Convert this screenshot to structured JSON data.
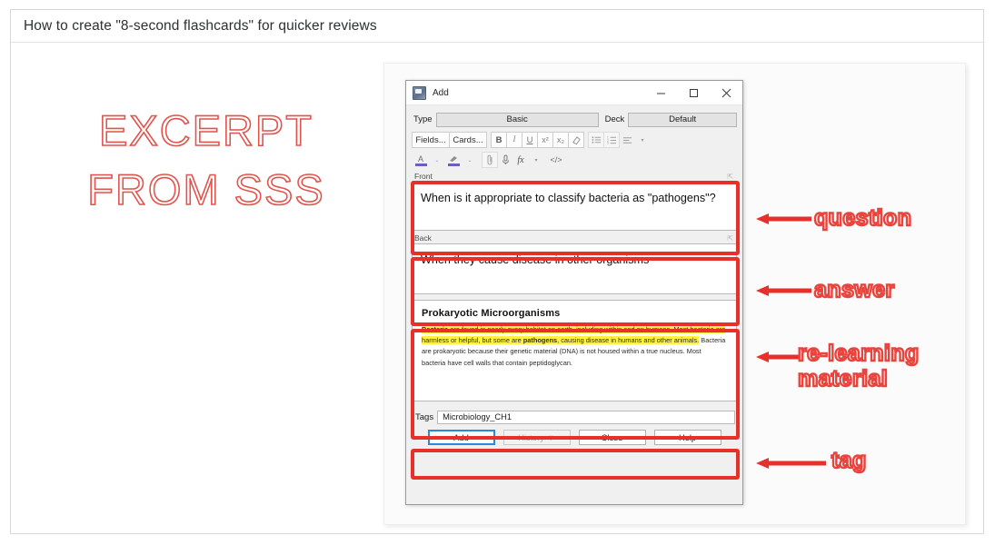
{
  "page": {
    "title": "How to create \"8-second flashcards\" for quicker reviews"
  },
  "watermark": {
    "line1": "EXCERPT",
    "line2": "FROM SSS",
    "color": "#e2534c"
  },
  "anki": {
    "window_title": "Add",
    "app_icon": "anki-app-icon",
    "window_controls": {
      "minimize": "minimize-icon",
      "maximize": "maximize-icon",
      "close": "close-icon"
    },
    "type_label": "Type",
    "type_value": "Basic",
    "deck_label": "Deck",
    "deck_value": "Default",
    "toolbar": {
      "fields_button": "Fields...",
      "cards_button": "Cards...",
      "bold": "B",
      "italic": "I",
      "underline": "U",
      "superscript": "x²",
      "subscript": "x₂",
      "remove_formatting": "eraser-icon",
      "bullet_list": "bullet-list-icon",
      "numbered_list": "numbered-list-icon",
      "align": "align-icon",
      "align_caret": "▾",
      "text_color": "A",
      "text_color_caret": "⌄",
      "highlight_color": "highlighter-icon",
      "highlight_caret": "⌄",
      "attach": "paperclip-icon",
      "record": "microphone-icon",
      "equation": "fx",
      "equation_caret": "▾",
      "html_editor": "</>"
    },
    "fields": [
      {
        "name": "Front",
        "pin": "pin-icon",
        "value": "When is it appropriate to classify bacteria as \"pathogens\"?"
      },
      {
        "name": "Back",
        "pin": "pin-icon",
        "value": "When they cause disease in other organisms"
      }
    ],
    "material": {
      "heading": "Prokaryotic Microorganisms",
      "paragraph_parts": [
        {
          "text": "Bacteria",
          "highlight": true,
          "bold": true
        },
        {
          "text": " are found in nearly every habitat on earth, including within and on humans. Most bacteria are harmless or helpful, but some are ",
          "highlight": true,
          "bold": false
        },
        {
          "text": "pathogens",
          "highlight": true,
          "bold": true
        },
        {
          "text": ", causing disease in humans and other animals.",
          "highlight": true,
          "bold": false
        },
        {
          "text": " Bacteria are prokaryotic because their genetic material (DNA) is not housed within a true nucleus. Most bacteria have cell walls that contain peptidoglycan.",
          "highlight": false,
          "bold": false
        }
      ],
      "highlight_color": "#fff33f"
    },
    "tags_label": "Tags",
    "tags_value": "Microbiology_CH1",
    "buttons": {
      "add": "Add",
      "history": "History ▼",
      "close": "Close",
      "help": "Help"
    }
  },
  "annotations": {
    "accent_color": "#e8302a",
    "items": [
      {
        "label": "question",
        "label2": ""
      },
      {
        "label": "answer",
        "label2": ""
      },
      {
        "label": "re-learning",
        "label2": "material"
      },
      {
        "label": "tag",
        "label2": ""
      }
    ]
  }
}
